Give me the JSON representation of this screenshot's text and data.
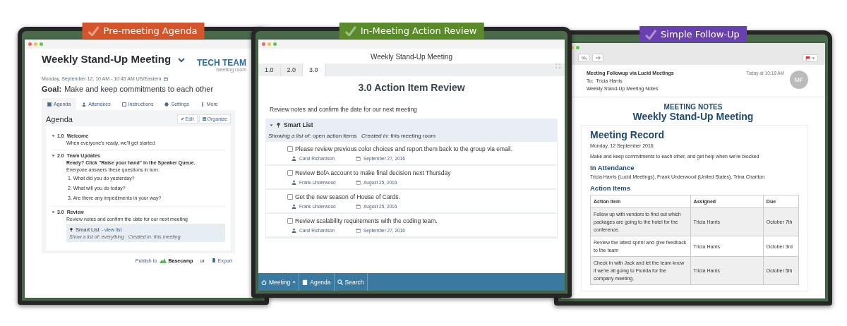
{
  "panels": [
    {
      "kind": "agenda",
      "badge": "Pre-meeting Agenda",
      "color": "#d4552b",
      "title": "Weekly Stand-Up Meeting",
      "logo_title": "TECH TEAM",
      "logo_subtitle": "meeting room",
      "datetime": "Monday, September 12, 10 AM - 10:45 AM US/Eastern",
      "goal_label": "Goal:",
      "goal": "Make and keep commitments to each other",
      "tabs": [
        {
          "label": "Agenda",
          "selected": true
        },
        {
          "label": "Attendees",
          "selected": false
        },
        {
          "label": "Instructions",
          "selected": false
        },
        {
          "label": "Settings",
          "selected": false
        },
        {
          "label": "More",
          "selected": false
        }
      ],
      "section_title": "Agenda",
      "actions": [
        "Edit",
        "Organize"
      ],
      "items": [
        {
          "number": "1.0",
          "title": "Welcome",
          "lines": [
            {
              "text": "When everyone's ready, we'll get started.",
              "bold": false
            }
          ]
        },
        {
          "number": "2.0",
          "title": "Team Updates",
          "lines": [
            {
              "text": "Ready? Click \"Raise your hand\" in the Speaker Queue.",
              "bold": true
            },
            {
              "text": "Everyone answers these questions in turn:",
              "bold": false
            }
          ],
          "list": [
            "1. What did you do yesterday?",
            "2. What will you do today?",
            "3. Are there any impediments in your way?"
          ]
        },
        {
          "number": "3.0",
          "title": "Review",
          "lines": [
            {
              "text": "Review notes and confirm the date for our next meeting",
              "bold": false
            }
          ],
          "smart_list": {
            "title": "Smart List",
            "link": "- view list",
            "filter": "Show a list of: everything   Created in: this meeting"
          }
        }
      ],
      "publish_label": "Publish to",
      "service": "Basecamp",
      "or": "or",
      "export": "Export"
    },
    {
      "kind": "review",
      "badge": "In-Meeting Action Review",
      "color": "#5a8a2a",
      "title": "Weekly Stand-Up Meeting",
      "tabs": [
        {
          "label": "1.0",
          "selected": false
        },
        {
          "label": "2.0",
          "selected": false
        },
        {
          "label": "3.0",
          "selected": true
        }
      ],
      "heading": "3.0 Action Item Review",
      "description": "Review notes and confirm the date for our next meeting",
      "smart_list": "Smart List",
      "filter": "*Showing a list of:* open action items   *Created in:* this meeting room",
      "action_items": [
        {
          "text": "Please review previous color choices and report them back to the group via email.",
          "checked": false,
          "assignee": "Carol Richardson",
          "due": "September 27, 2016"
        },
        {
          "text": "Review BofA account to make final decision next Thursday",
          "checked": false,
          "assignee": "Frank Underwood",
          "due": "August 25, 2016"
        },
        {
          "text": "Get the new season of House of Cards.",
          "checked": false,
          "assignee": "Frank Underwood",
          "due": "August 25, 2016"
        },
        {
          "text": "Review scalability requirements with the coding team.",
          "checked": false,
          "assignee": "Carol Richardson",
          "due": "September 27, 2016"
        }
      ],
      "toolbar": [
        "Meeting",
        "Agenda",
        "Search"
      ]
    },
    {
      "kind": "email",
      "badge": "Simple Follow-Up",
      "color": "#6a3fb0",
      "subject": "Meeting Followup via Lucid Meetings",
      "to_label": "To:",
      "to": "Tricia Harris",
      "title": "Weekly Stand-Up Meeting Notes",
      "time": "Today at 10:18 AM",
      "avatar": "MF",
      "kicker": "MEETING NOTES",
      "heading": "Weekly Stand-Up Meeting",
      "record_title": "Meeting Record",
      "date": "Monday, 12 September 2016",
      "goal": "Make and keep commitments to each other, and get help when we're blocked",
      "attendance_title": "In Attendance",
      "attendees": "Tricia Harris (Lucid Meetings), Frank Underwood (United States), Trina Charlton",
      "actions_title": "Action Items",
      "columns": [
        "Action Item",
        "Assigned",
        "Due"
      ],
      "rows": [
        [
          "Follow up with vendors to find out which packages are going to the hotel for the conference.",
          "Tricia Harris",
          "October 7th"
        ],
        [
          "Review the latest sprint and give feedback to the team",
          "Tricia Harris",
          "October 3rd"
        ],
        [
          "Check in with Jack and let the team know if we're all going to Florida for the company meeting.",
          "Tricia Harris",
          "October 5th"
        ]
      ]
    }
  ]
}
